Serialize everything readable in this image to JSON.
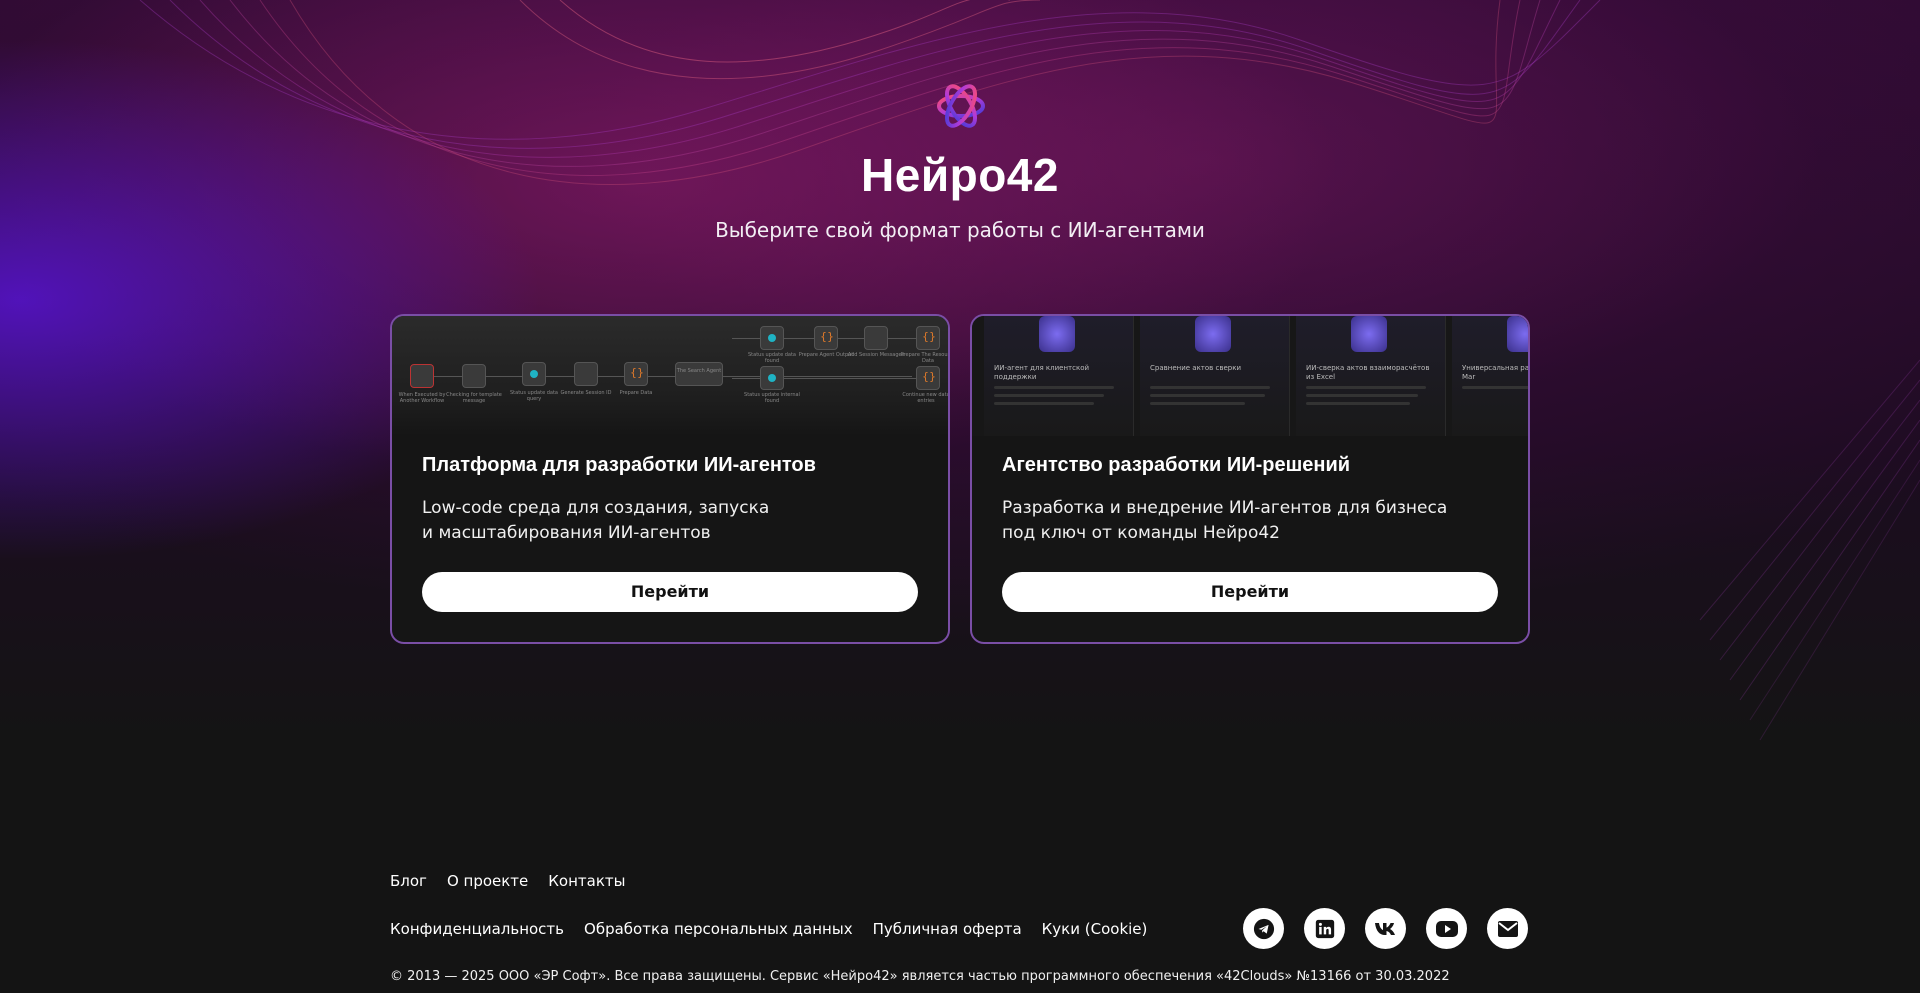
{
  "hero": {
    "title": "Нейро42",
    "subtitle": "Выберите свой формат работы с ИИ-агентами",
    "logo_icon": "nejro42-logo-icon"
  },
  "cards": [
    {
      "title": "Платформа для разработки ИИ-агентов",
      "desc_line1": "Low-code среда для создания, запуска",
      "desc_line2": "и масштабирования ИИ-агентов",
      "button": "Перейти"
    },
    {
      "title": "Агентство разработки ИИ-решений",
      "desc_line1": "Разработка и внедрение ИИ-агентов для бизнеса",
      "desc_line2": "под ключ от команды Нейро42",
      "button": "Перейти",
      "tiles": [
        "ИИ-агент для клиентской поддержки",
        "Сравнение актов сверки",
        "ИИ-сверка актов взаиморасчётов из Excel",
        "Универсальная ра документов в Mar"
      ]
    }
  ],
  "workflow_nodes": [
    "When Executed by Another Workflow",
    "Checking for template message",
    "Status update data query",
    "Generate Session ID",
    "Prepare Data",
    "The Search Agent",
    "Status update data found",
    "Prepare Agent Output",
    "Add Session Messages",
    "Prepare The Resource Data",
    "Status update internal found",
    "Continue new data entries"
  ],
  "footer": {
    "nav": [
      "Блог",
      "О проекте",
      "Контакты"
    ],
    "legal": [
      "Конфиденциальность",
      "Обработка персональных данных",
      "Публичная оферта",
      "Куки (Cookie)"
    ],
    "social": [
      "telegram-icon",
      "linkedin-icon",
      "vk-icon",
      "youtube-icon",
      "mail-icon"
    ],
    "copyright": "© 2013 — 2025  ООО «ЭР Софт». Все права защищены. Сервис «Нейро42» является частью программного обеспечения «42Clouds» №13166 от 30.03.2022"
  },
  "colors": {
    "background": "#141414",
    "card_border": "#7a4ea6",
    "accent_purple": "#5814d2",
    "accent_magenta": "#961e6e"
  }
}
